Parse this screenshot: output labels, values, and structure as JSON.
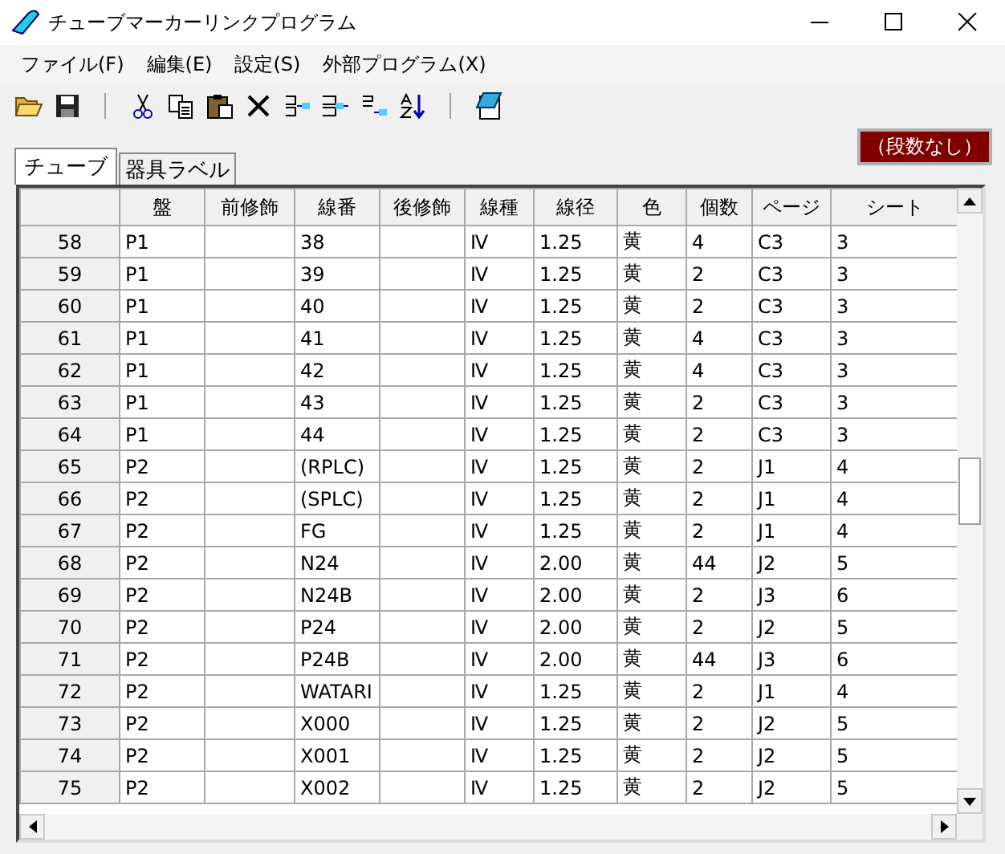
{
  "window": {
    "title": "チューブマーカーリンクプログラム"
  },
  "menu": [
    "ファイル(F)",
    "編集(E)",
    "設定(S)",
    "外部プログラム(X)"
  ],
  "tabs": [
    {
      "label": "チューブ",
      "selected": true
    },
    {
      "label": "器具ラベル",
      "selected": false
    }
  ],
  "status_badge": "（段数なし）",
  "table": {
    "columns": [
      "盤",
      "前修飾",
      "線番",
      "後修飾",
      "線種",
      "線径",
      "色",
      "個数",
      "ページ",
      "シート"
    ],
    "rows": [
      {
        "number": "58",
        "cells": [
          "P1",
          "",
          "38",
          "",
          "Ⅳ",
          "1.25",
          "黄",
          "4",
          "C3",
          "3"
        ]
      },
      {
        "number": "59",
        "cells": [
          "P1",
          "",
          "39",
          "",
          "Ⅳ",
          "1.25",
          "黄",
          "2",
          "C3",
          "3"
        ]
      },
      {
        "number": "60",
        "cells": [
          "P1",
          "",
          "40",
          "",
          "Ⅳ",
          "1.25",
          "黄",
          "2",
          "C3",
          "3"
        ]
      },
      {
        "number": "61",
        "cells": [
          "P1",
          "",
          "41",
          "",
          "Ⅳ",
          "1.25",
          "黄",
          "4",
          "C3",
          "3"
        ]
      },
      {
        "number": "62",
        "cells": [
          "P1",
          "",
          "42",
          "",
          "Ⅳ",
          "1.25",
          "黄",
          "4",
          "C3",
          "3"
        ]
      },
      {
        "number": "63",
        "cells": [
          "P1",
          "",
          "43",
          "",
          "Ⅳ",
          "1.25",
          "黄",
          "2",
          "C3",
          "3"
        ]
      },
      {
        "number": "64",
        "cells": [
          "P1",
          "",
          "44",
          "",
          "Ⅳ",
          "1.25",
          "黄",
          "2",
          "C3",
          "3"
        ]
      },
      {
        "number": "65",
        "cells": [
          "P2",
          "",
          "(RPLC)",
          "",
          "Ⅳ",
          "1.25",
          "黄",
          "2",
          "J1",
          "4"
        ]
      },
      {
        "number": "66",
        "cells": [
          "P2",
          "",
          "(SPLC)",
          "",
          "Ⅳ",
          "1.25",
          "黄",
          "2",
          "J1",
          "4"
        ]
      },
      {
        "number": "67",
        "cells": [
          "P2",
          "",
          "FG",
          "",
          "Ⅳ",
          "1.25",
          "黄",
          "2",
          "J1",
          "4"
        ]
      },
      {
        "number": "68",
        "cells": [
          "P2",
          "",
          "N24",
          "",
          "Ⅳ",
          "2.00",
          "黄",
          "44",
          "J2",
          "5"
        ]
      },
      {
        "number": "69",
        "cells": [
          "P2",
          "",
          "N24B",
          "",
          "Ⅳ",
          "2.00",
          "黄",
          "2",
          "J3",
          "6"
        ]
      },
      {
        "number": "70",
        "cells": [
          "P2",
          "",
          "P24",
          "",
          "Ⅳ",
          "2.00",
          "黄",
          "2",
          "J2",
          "5"
        ]
      },
      {
        "number": "71",
        "cells": [
          "P2",
          "",
          "P24B",
          "",
          "Ⅳ",
          "2.00",
          "黄",
          "44",
          "J3",
          "6"
        ]
      },
      {
        "number": "72",
        "cells": [
          "P2",
          "",
          "WATARI",
          "",
          "Ⅳ",
          "1.25",
          "黄",
          "2",
          "J1",
          "4"
        ]
      },
      {
        "number": "73",
        "cells": [
          "P2",
          "",
          "X000",
          "",
          "Ⅳ",
          "1.25",
          "黄",
          "2",
          "J2",
          "5"
        ]
      },
      {
        "number": "74",
        "cells": [
          "P2",
          "",
          "X001",
          "",
          "Ⅳ",
          "1.25",
          "黄",
          "2",
          "J2",
          "5"
        ]
      },
      {
        "number": "75",
        "cells": [
          "P2",
          "",
          "X002",
          "",
          "Ⅳ",
          "1.25",
          "黄",
          "2",
          "J2",
          "5"
        ]
      }
    ]
  }
}
